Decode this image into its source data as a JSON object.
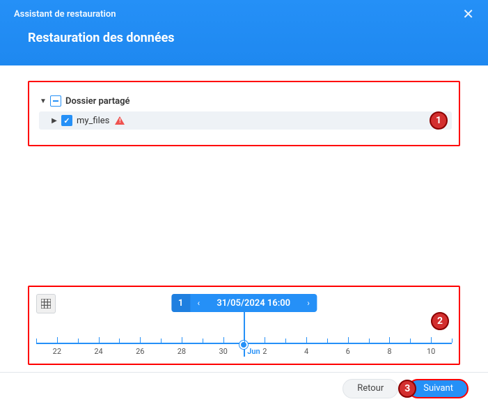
{
  "header": {
    "assistant_label": "Assistant de restauration",
    "title": "Restauration des données",
    "close_icon": "close-icon"
  },
  "tree": {
    "root": {
      "label": "Dossier partagé"
    },
    "items": [
      {
        "label": "my_files",
        "has_warning": true
      }
    ]
  },
  "timeline": {
    "count": "1",
    "selected_datetime": "31/05/2024 16:00",
    "month_label": "Jun",
    "ticks": [
      "22",
      "24",
      "26",
      "28",
      "30",
      "2",
      "4",
      "6",
      "8",
      "10"
    ]
  },
  "footer": {
    "back_label": "Retour",
    "next_label": "Suivant"
  },
  "annotations": {
    "step1": "1",
    "step2": "2",
    "step3": "3"
  }
}
